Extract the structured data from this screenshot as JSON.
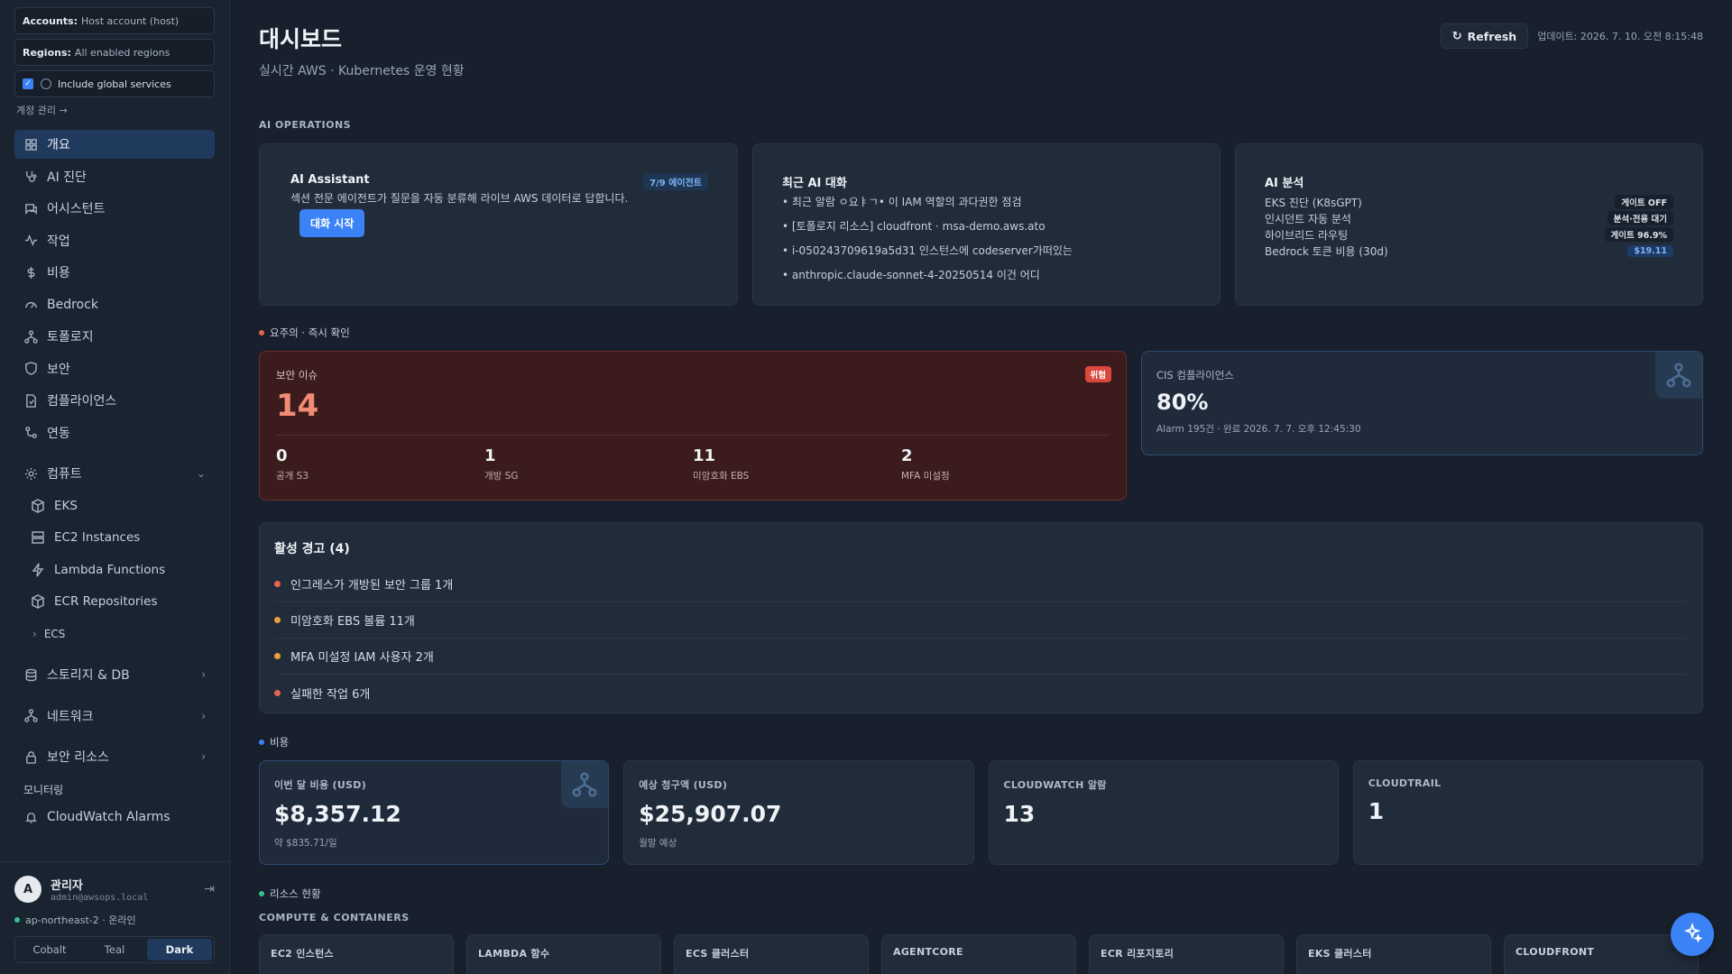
{
  "sidebar": {
    "accounts_label": "Accounts:",
    "accounts_value": "Host account (host)",
    "regions_label": "Regions:",
    "regions_value": "All enabled regions",
    "global_label": "Include global services",
    "manage_link": "계정 관리 →",
    "items": [
      {
        "label": "개요",
        "icon": "grid-icon"
      },
      {
        "label": "AI 진단",
        "icon": "stethoscope-icon"
      },
      {
        "label": "어시스턴트",
        "icon": "chat-icon"
      },
      {
        "label": "작업",
        "icon": "activity-icon"
      },
      {
        "label": "비용",
        "icon": "dollar-icon"
      },
      {
        "label": "Bedrock",
        "icon": "gauge-icon"
      },
      {
        "label": "토폴로지",
        "icon": "network-icon"
      },
      {
        "label": "보안",
        "icon": "shield-icon"
      },
      {
        "label": "컴플라이언스",
        "icon": "file-check-icon"
      },
      {
        "label": "연동",
        "icon": "link-icon"
      }
    ],
    "compute_label": "컴퓨트",
    "compute_items": [
      "EKS",
      "EC2 Instances",
      "Lambda Functions",
      "ECR Repositories"
    ],
    "ecs_label": "ECS",
    "storage_label": "스토리지 & DB",
    "network_label": "네트워크",
    "security_res_label": "보안 리소스",
    "monitoring_label": "모니터링",
    "cloudwatch_label": "CloudWatch Alarms",
    "user": {
      "initial": "A",
      "name": "관리자",
      "email": "admin@awsops.local",
      "region_status": "ap-northeast-2 · 온라인"
    },
    "themes": [
      "Cobalt",
      "Teal",
      "Dark"
    ]
  },
  "header": {
    "title": "대시보드",
    "subtitle": "실시간 AWS · Kubernetes 운영 현황",
    "refresh_label": "Refresh",
    "updated": "업데이트: 2026. 7. 10. 오전 8:15:48"
  },
  "ai_ops": {
    "section_label": "AI OPERATIONS",
    "assistant": {
      "title": "AI Assistant",
      "badge": "7/9 에이전트",
      "desc": "섹션 전문 에이전트가 질문을 자동 분류해 라이브 AWS 데이터로 답합니다.",
      "button": "대화 시작"
    },
    "recent": {
      "title": "최근 AI 대화",
      "items": [
        "• 최근 알람 ㅇ요ㅑㄱ• 이 IAM 역할의 과다권한 점검",
        "• [토폴로지 리소스] cloudfront · msa-demo.aws.ato",
        "• i-050243709619a5d31 인스턴스에 codeserver가떠있는",
        "• anthropic.claude-sonnet-4-20250514 이건 어디"
      ]
    },
    "analysis": {
      "title": "AI 분석",
      "rows": [
        {
          "label": "EKS 진단 (K8sGPT)",
          "value": "게이트 OFF"
        },
        {
          "label": "인시던트 자동 분석",
          "value": "분석·전용 대기"
        },
        {
          "label": "하이브리드 라우팅",
          "value": "게이트 96.9%"
        },
        {
          "label": "Bedrock 토큰 비용 (30d)",
          "value": "$19.11"
        }
      ]
    }
  },
  "attention": {
    "section_label": "요주의 · 즉시 확인",
    "security": {
      "label": "보안 이슈",
      "value": "14",
      "badge": "위험",
      "stats": [
        {
          "value": "0",
          "label": "공개 S3"
        },
        {
          "value": "1",
          "label": "개방 SG"
        },
        {
          "value": "11",
          "label": "미암호화 EBS"
        },
        {
          "value": "2",
          "label": "MFA 미설정"
        }
      ]
    },
    "cis": {
      "label": "CIS 컴플라이언스",
      "value": "80%",
      "sub": "Alarm 195건 · 완료 2026. 7. 7. 오후 12:45:30"
    }
  },
  "alerts": {
    "title": "활성 경고 (4)",
    "items": [
      {
        "text": "인그레스가 개방된 보안 그룹 1개",
        "color": "#e5654f"
      },
      {
        "text": "미암호화 EBS 볼륨 11개",
        "color": "#e9a23b"
      },
      {
        "text": "MFA 미설정 IAM 사용자 2개",
        "color": "#e9a23b"
      },
      {
        "text": "실패한 작업 6개",
        "color": "#e5654f"
      }
    ]
  },
  "cost": {
    "section_label": "비용",
    "cards": [
      {
        "label": "이번 달 비용 (USD)",
        "value": "$8,357.12",
        "sub": "약 $835.71/일"
      },
      {
        "label": "예상 청구액 (USD)",
        "value": "$25,907.07",
        "sub": "월말 예상"
      },
      {
        "label": "CLOUDWATCH 알람",
        "value": "13",
        "sub": ""
      },
      {
        "label": "CLOUDTRAIL",
        "value": "1",
        "sub": ""
      }
    ]
  },
  "resources": {
    "section_label": "리소스 현황",
    "group_label": "COMPUTE & CONTAINERS",
    "cards": [
      "EC2 인스턴스",
      "LAMBDA 함수",
      "ECS 클러스터",
      "AGENTCORE",
      "ECR 리포지토리",
      "EKS 클러스터",
      "CLOUDFRONT"
    ]
  },
  "colors": {
    "accent": "#3b82f6",
    "danger": "#e5654f",
    "warning": "#e9a23b",
    "success": "#34c18b"
  }
}
